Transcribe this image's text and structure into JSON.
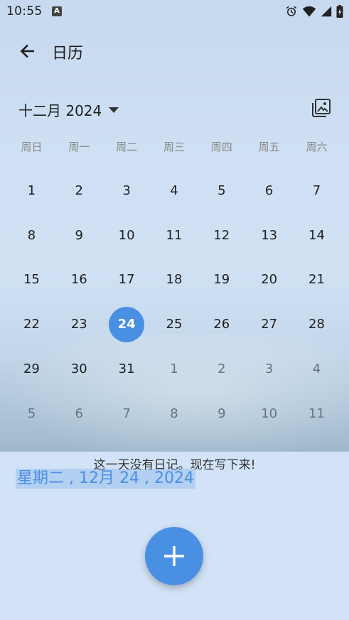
{
  "status_bar": {
    "time": "10:55",
    "notif_letter": "A",
    "icons": [
      "alarm-icon",
      "wifi-icon",
      "signal-icon",
      "battery-icon"
    ]
  },
  "app_bar": {
    "title": "日历"
  },
  "calendar": {
    "month_label": "十二月 2024",
    "weekdays": [
      "周日",
      "周一",
      "周二",
      "周三",
      "周四",
      "周五",
      "周六"
    ],
    "weeks": [
      [
        {
          "d": "1",
          "o": false
        },
        {
          "d": "2",
          "o": false
        },
        {
          "d": "3",
          "o": false
        },
        {
          "d": "4",
          "o": false
        },
        {
          "d": "5",
          "o": false
        },
        {
          "d": "6",
          "o": false
        },
        {
          "d": "7",
          "o": false
        }
      ],
      [
        {
          "d": "8",
          "o": false
        },
        {
          "d": "9",
          "o": false
        },
        {
          "d": "10",
          "o": false
        },
        {
          "d": "11",
          "o": false
        },
        {
          "d": "12",
          "o": false
        },
        {
          "d": "13",
          "o": false
        },
        {
          "d": "14",
          "o": false
        }
      ],
      [
        {
          "d": "15",
          "o": false
        },
        {
          "d": "16",
          "o": false
        },
        {
          "d": "17",
          "o": false
        },
        {
          "d": "18",
          "o": false
        },
        {
          "d": "19",
          "o": false
        },
        {
          "d": "20",
          "o": false
        },
        {
          "d": "21",
          "o": false
        }
      ],
      [
        {
          "d": "22",
          "o": false
        },
        {
          "d": "23",
          "o": false
        },
        {
          "d": "24",
          "o": false,
          "s": true
        },
        {
          "d": "25",
          "o": false
        },
        {
          "d": "26",
          "o": false
        },
        {
          "d": "27",
          "o": false
        },
        {
          "d": "28",
          "o": false
        }
      ],
      [
        {
          "d": "29",
          "o": false
        },
        {
          "d": "30",
          "o": false
        },
        {
          "d": "31",
          "o": false
        },
        {
          "d": "1",
          "o": true
        },
        {
          "d": "2",
          "o": true
        },
        {
          "d": "3",
          "o": true
        },
        {
          "d": "4",
          "o": true
        }
      ],
      [
        {
          "d": "5",
          "o": true
        },
        {
          "d": "6",
          "o": true
        },
        {
          "d": "7",
          "o": true
        },
        {
          "d": "8",
          "o": true
        },
        {
          "d": "9",
          "o": true
        },
        {
          "d": "10",
          "o": true
        },
        {
          "d": "11",
          "o": true
        }
      ]
    ]
  },
  "sheet": {
    "empty_message": "这一天没有日记。现在写下来!",
    "selected_date": "星期二 , 12月 24 , 2024"
  },
  "colors": {
    "accent": "#4a90e2",
    "sheet_bg": "#d3e3f7"
  }
}
